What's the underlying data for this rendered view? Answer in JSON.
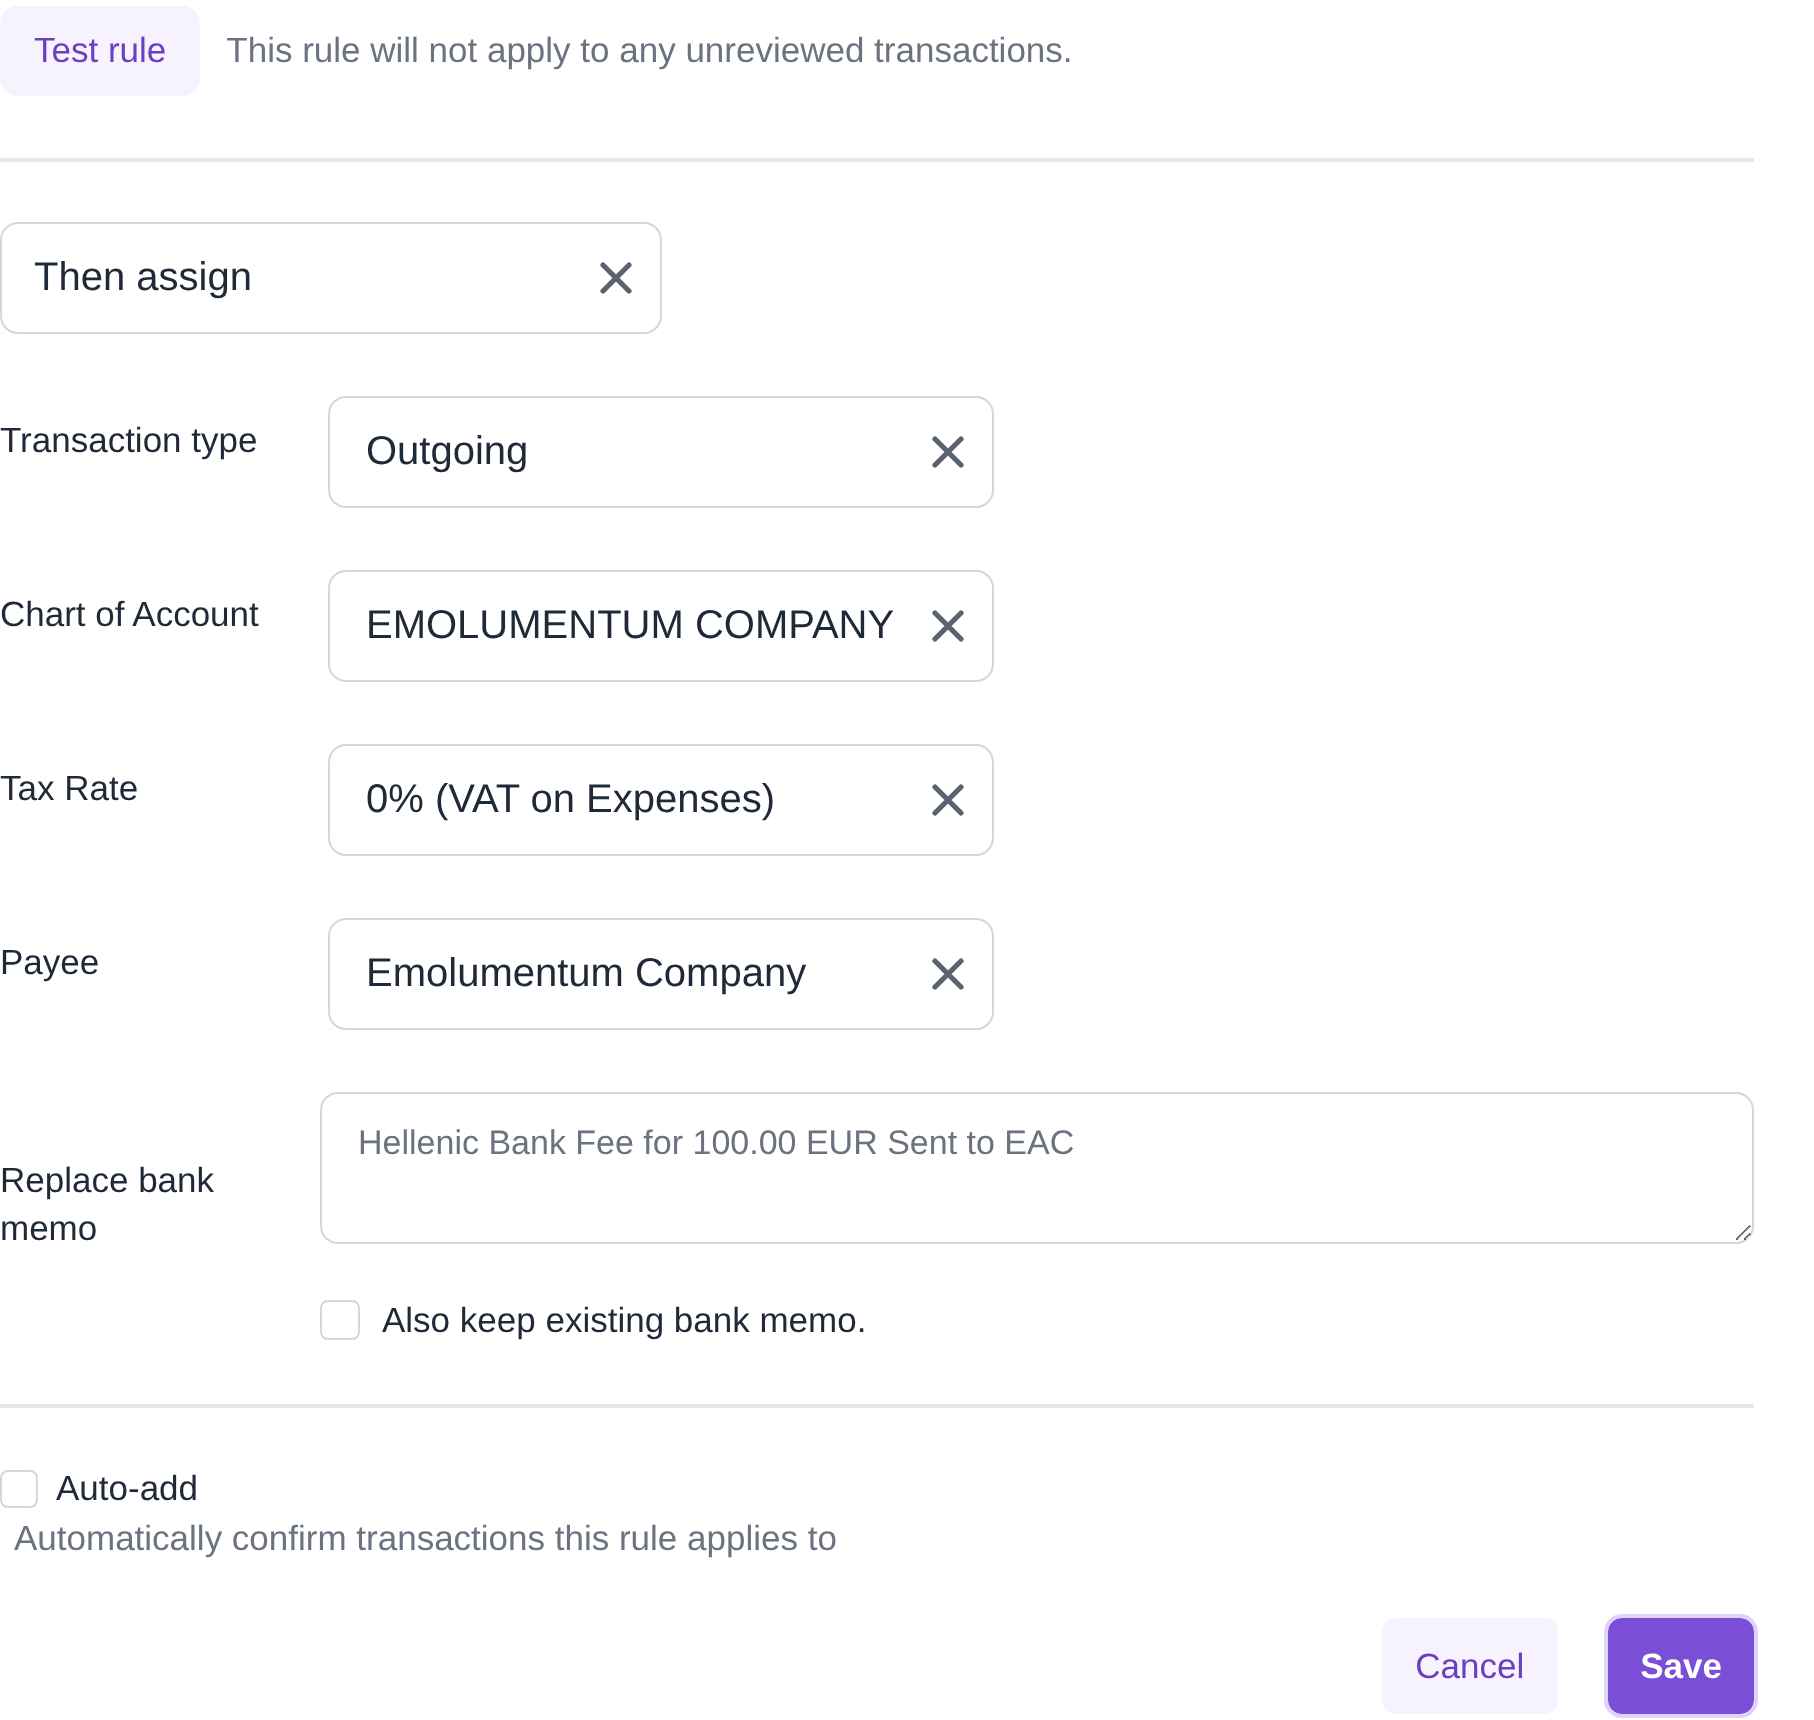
{
  "test_rule": {
    "button": "Test rule",
    "note": "This rule will not apply to any unreviewed transactions."
  },
  "action_select": {
    "value": "Then assign"
  },
  "assignments": [
    {
      "label": "Transaction type",
      "value": "Outgoing"
    },
    {
      "label": "Chart of Account",
      "value": "EMOLUMENTUM COMPANY"
    },
    {
      "label": "Tax Rate",
      "value": "0% (VAT on Expenses)"
    },
    {
      "label": "Payee",
      "value": "Emolumentum Company"
    }
  ],
  "memo": {
    "label": "Replace bank memo",
    "placeholder": "Hellenic Bank Fee for 100.00 EUR Sent to EAC"
  },
  "keep_memo": {
    "label": "Also keep existing bank memo.",
    "checked": false
  },
  "auto_add": {
    "label": "Auto-add",
    "description": "Automatically confirm transactions this rule applies to",
    "checked": false
  },
  "buttons": [
    {
      "label": "Cancel",
      "kind": "secondary",
      "focused": false
    },
    {
      "label": "Save",
      "kind": "primary",
      "focused": true
    }
  ]
}
